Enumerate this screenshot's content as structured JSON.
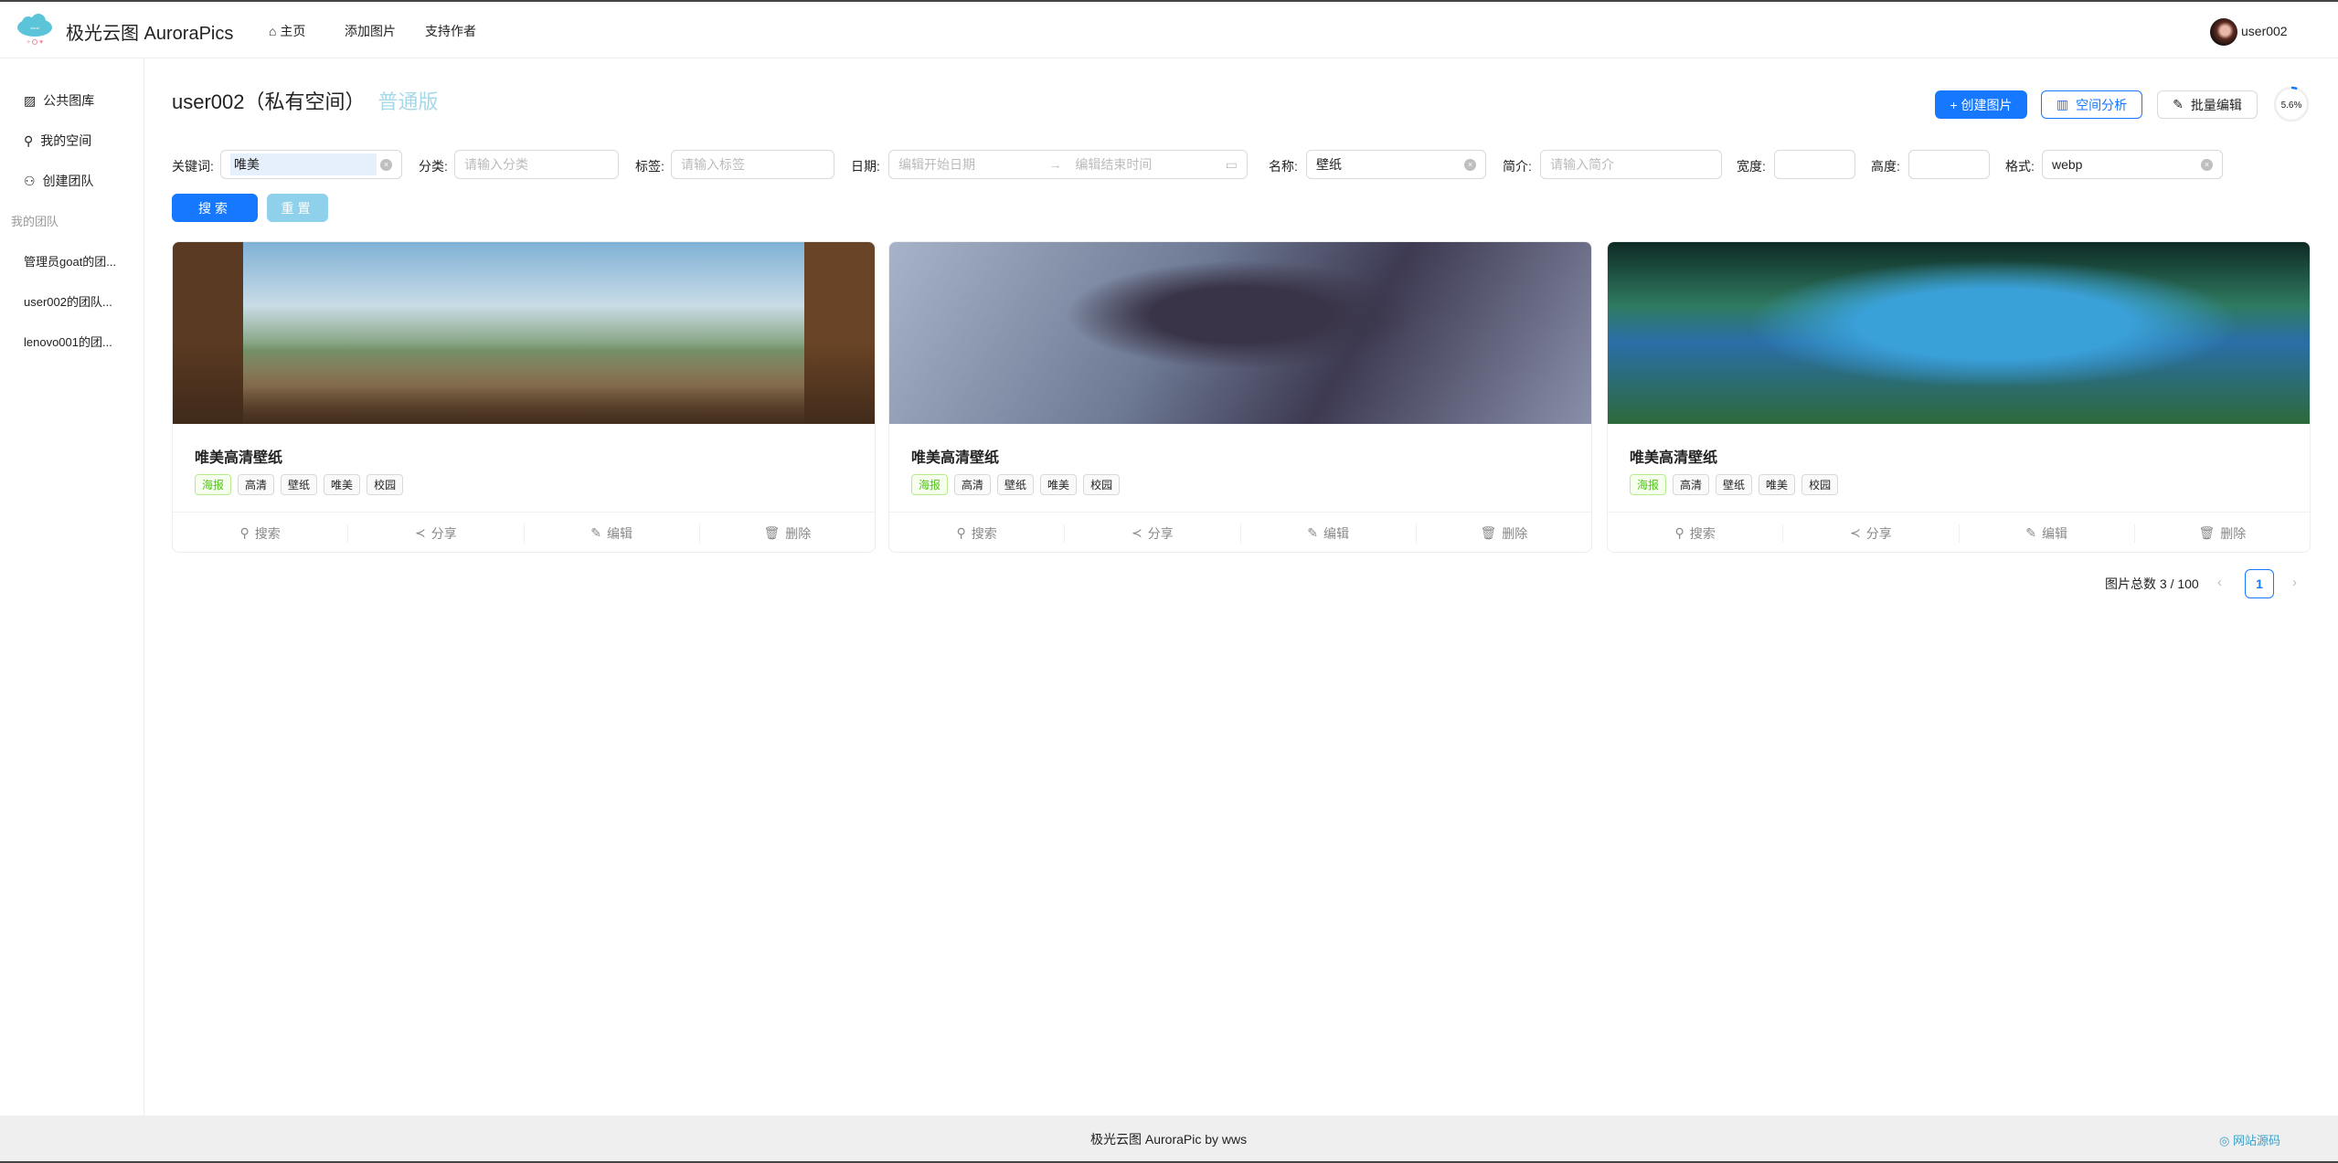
{
  "header": {
    "app_title": "极光云图 AuroraPics",
    "nav": [
      {
        "label": "主页",
        "icon": "home-icon"
      },
      {
        "label": "添加图片"
      },
      {
        "label": "支持作者"
      }
    ],
    "username": "user002"
  },
  "sidebar": {
    "items": [
      {
        "label": "公共图库",
        "icon": "picture-icon"
      },
      {
        "label": "我的空间",
        "icon": "user-icon"
      },
      {
        "label": "创建团队",
        "icon": "team-icon"
      }
    ],
    "group_label": "我的团队",
    "teams": [
      "管理员goat的团...",
      "user002的团队...",
      "lenovo001的团..."
    ]
  },
  "page": {
    "title": "user002（私有空间）",
    "level": "普通版",
    "create_label": "+ 创建图片",
    "analyze_label": "空间分析",
    "batch_edit_label": "批量编辑",
    "usage_percent": 5.6,
    "usage_text": "5.6%"
  },
  "filters": {
    "keyword": {
      "label": "关键词:",
      "value": "唯美"
    },
    "category": {
      "label": "分类:",
      "placeholder": "请输入分类"
    },
    "tags": {
      "label": "标签:",
      "placeholder": "请输入标签"
    },
    "date": {
      "label": "日期:",
      "start_placeholder": "编辑开始日期",
      "end_placeholder": "编辑结束时间"
    },
    "name": {
      "label": "名称:",
      "value": "壁纸"
    },
    "intro": {
      "label": "简介:",
      "placeholder": "请输入简介"
    },
    "width": {
      "label": "宽度:",
      "value": ""
    },
    "height": {
      "label": "高度:",
      "value": ""
    },
    "format": {
      "label": "格式:",
      "value": "webp"
    },
    "search_label": "搜索",
    "reset_label": "重置"
  },
  "cards": [
    {
      "title": "唯美高清壁纸",
      "category": "海报",
      "tags": [
        "高清",
        "壁纸",
        "唯美",
        "校园"
      ]
    },
    {
      "title": "唯美高清壁纸",
      "category": "海报",
      "tags": [
        "高清",
        "壁纸",
        "唯美",
        "校园"
      ]
    },
    {
      "title": "唯美高清壁纸",
      "category": "海报",
      "tags": [
        "高清",
        "壁纸",
        "唯美",
        "校园"
      ]
    }
  ],
  "card_actions": [
    "搜索",
    "分享",
    "编辑",
    "删除"
  ],
  "pagination": {
    "total_text": "图片总数 3 / 100",
    "current": "1",
    "prev": "‹",
    "next": "›"
  },
  "footer": {
    "text": "极光云图 AuroraPic by wws",
    "link": "网站源码"
  },
  "colors": {
    "primary": "#1677ff",
    "level": "#a6d8e8",
    "reset": "#8fd0ea"
  }
}
